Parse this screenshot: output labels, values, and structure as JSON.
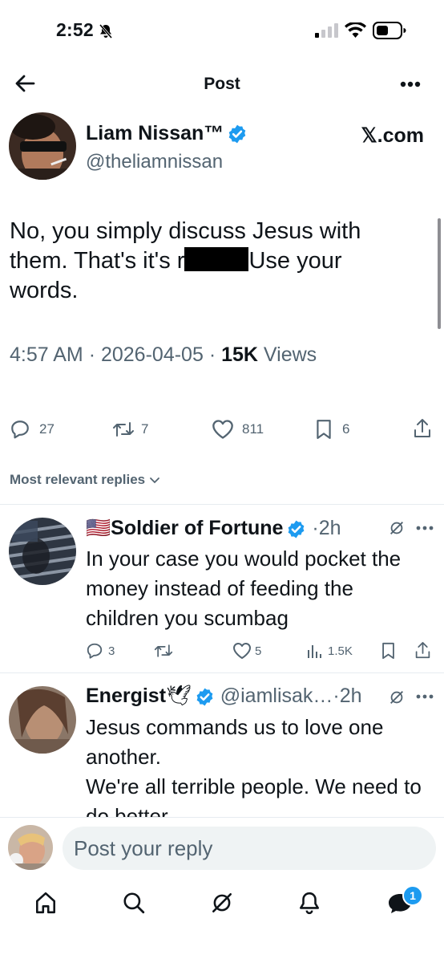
{
  "status_bar": {
    "time": "2:52"
  },
  "header": {
    "title": "Post",
    "back_icon": "arrow-left-icon",
    "more_icon": "more-horizontal-icon"
  },
  "main_tweet": {
    "author_name": "Liam Nissan™",
    "handle": "@theliamnissan",
    "source_label": "𝕏.com",
    "text_line1": "No, you simply discuss Jesus with",
    "text_line2_before": "them. That's it's r",
    "text_line2_after": "Use your",
    "text_line3": "words.",
    "time": "4:57 AM",
    "date": "2026-04-05",
    "views_count": "15K",
    "views_label": "Views",
    "separator": "·",
    "stats": {
      "replies": "27",
      "reposts": "7",
      "likes": "811",
      "bookmarks": "6"
    }
  },
  "replies_filter": {
    "label": "Most relevant replies"
  },
  "replies": [
    {
      "flag": "🇺🇸",
      "author_name": "Soldier of Fortune",
      "time": "·2h",
      "lines": [
        "In your case you would pocket the",
        "money instead of feeding the",
        "children you scumbag"
      ],
      "stats": {
        "replies": "3",
        "likes": "5",
        "views": "1.5K"
      }
    },
    {
      "author_name": "Energist",
      "emoji": "🕊",
      "handle": "@iamlisak…",
      "time": "·2h",
      "lines": [
        "Jesus commands us to love one",
        "another.",
        "We're all terrible people. We need to",
        "do better"
      ]
    }
  ],
  "composer": {
    "placeholder": "Post your reply"
  },
  "bottom_nav": {
    "messages_badge": "1"
  },
  "colors": {
    "accent": "#1d9bf0",
    "muted": "#536471",
    "text": "#0f1419"
  }
}
